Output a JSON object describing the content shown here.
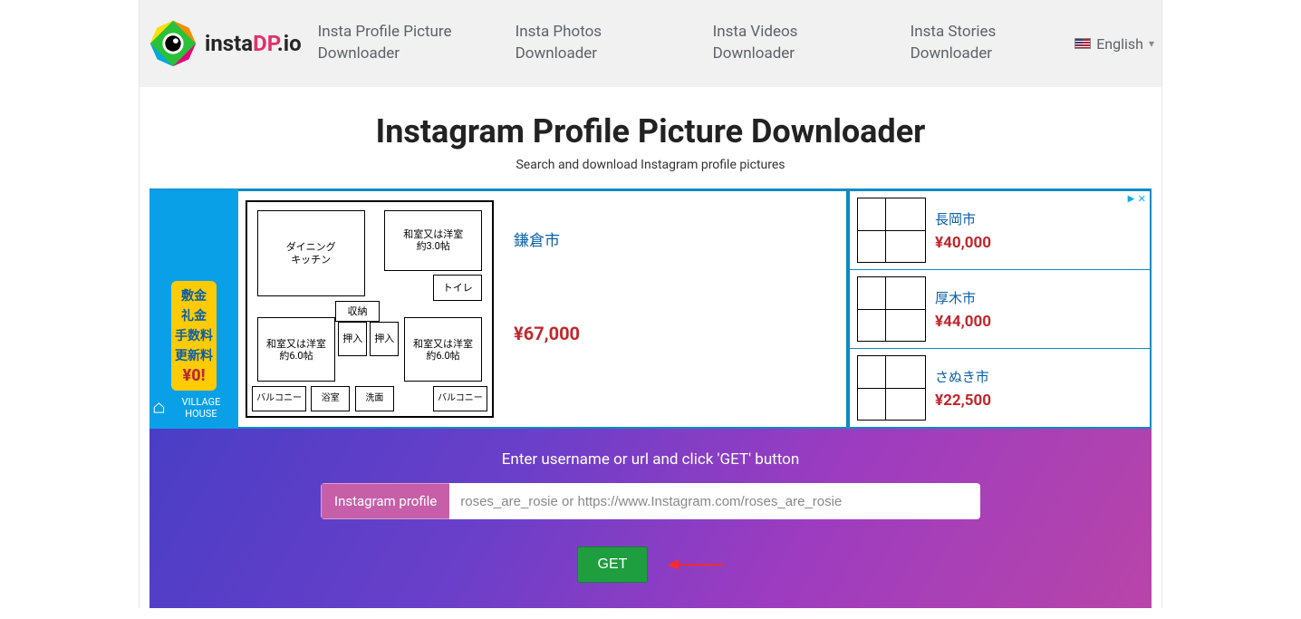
{
  "logo": {
    "pre": "insta",
    "mid": "DP",
    "suf": ".io"
  },
  "nav": {
    "profile": "Insta Profile Picture Downloader",
    "photos": "Insta Photos Downloader",
    "videos": "Insta Videos Downloader",
    "stories": "Insta Stories Downloader"
  },
  "lang": {
    "label": "English"
  },
  "heading": "Instagram Profile Picture Downloader",
  "subtitle": "Search and download Instagram profile pictures",
  "ad": {
    "tags": [
      "敷金",
      "礼金",
      "手数料",
      "更新料"
    ],
    "zero": "¥0!",
    "brand": "VILLAGE HOUSE",
    "main_city": "鎌倉市",
    "main_price": "¥67,000",
    "rooms": {
      "dk": "ダイニング\nキッチン",
      "wa3": "和室又は洋室\n約3.0帖",
      "wa6a": "和室又は洋室\n約6.0帖",
      "wa6b": "和室又は洋室\n約6.0帖",
      "toilet": "トイレ",
      "storage": "収納",
      "push_a": "押入",
      "push_b": "押入",
      "balc_a": "バルコニー",
      "bath": "浴室",
      "wash": "洗面",
      "balc_b": "バルコニー"
    },
    "right": [
      {
        "city": "長岡市",
        "price": "¥40,000"
      },
      {
        "city": "厚木市",
        "price": "¥44,000"
      },
      {
        "city": "さぬき市",
        "price": "¥22,500"
      }
    ]
  },
  "search": {
    "hint": "Enter username or url and click 'GET' button",
    "label": "Instagram profile",
    "placeholder": "roses_are_rosie or https://www.Instagram.com/roses_are_rosie",
    "button": "GET"
  }
}
